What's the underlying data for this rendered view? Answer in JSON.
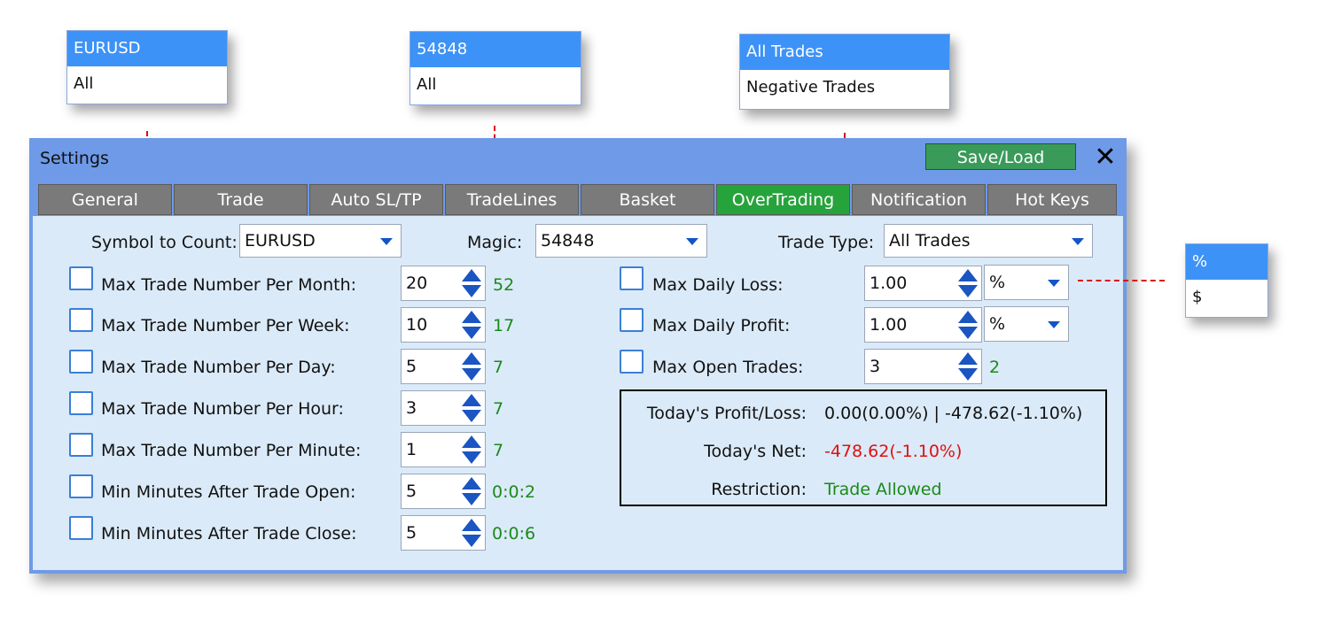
{
  "popups": {
    "symbol": {
      "options": [
        "EURUSD",
        "All"
      ],
      "selected": "EURUSD"
    },
    "magic": {
      "options": [
        "54848",
        "All"
      ],
      "selected": "54848"
    },
    "trade_type": {
      "options": [
        "All Trades",
        "Negative Trades"
      ],
      "selected": "All Trades"
    },
    "unit": {
      "options": [
        "%",
        "$"
      ],
      "selected": "%"
    }
  },
  "window": {
    "title": "Settings",
    "save_load_label": "Save/Load",
    "close_glyph": "✕"
  },
  "tabs": [
    {
      "label": "General",
      "active": false
    },
    {
      "label": "Trade",
      "active": false
    },
    {
      "label": "Auto SL/TP",
      "active": false
    },
    {
      "label": "TradeLines",
      "active": false
    },
    {
      "label": "Basket",
      "active": false
    },
    {
      "label": "OverTrading",
      "active": true
    },
    {
      "label": "Notification",
      "active": false
    },
    {
      "label": "Hot Keys",
      "active": false
    }
  ],
  "filters": {
    "symbol_label": "Symbol to Count:",
    "symbol_value": "EURUSD",
    "magic_label": "Magic:",
    "magic_value": "54848",
    "trade_type_label": "Trade Type:",
    "trade_type_value": "All Trades"
  },
  "left_rules": [
    {
      "label": "Max Trade Number Per Month:",
      "value": "20",
      "count": "52"
    },
    {
      "label": "Max Trade Number Per Week:",
      "value": "10",
      "count": "17"
    },
    {
      "label": "Max Trade Number Per Day:",
      "value": "5",
      "count": "7"
    },
    {
      "label": "Max Trade Number Per Hour:",
      "value": "3",
      "count": "7"
    },
    {
      "label": "Max Trade Number Per Minute:",
      "value": "1",
      "count": "7"
    },
    {
      "label": "Min Minutes After Trade Open:",
      "value": "5",
      "count": "0:0:2"
    },
    {
      "label": "Min Minutes After Trade Close:",
      "value": "5",
      "count": "0:0:6"
    }
  ],
  "right_rules": [
    {
      "label": "Max Daily Loss:",
      "value": "1.00",
      "unit": "%"
    },
    {
      "label": "Max Daily Profit:",
      "value": "1.00",
      "unit": "%"
    },
    {
      "label": "Max Open Trades:",
      "value": "3",
      "count": "2"
    }
  ],
  "info": {
    "pl_label": "Today's Profit/Loss:",
    "pl_value": "0.00(0.00%) | -478.62(-1.10%)",
    "net_label": "Today's Net:",
    "net_value": "-478.62(-1.10%)",
    "restriction_label": "Restriction:",
    "restriction_value": "Trade Allowed"
  },
  "colors": {
    "selected_option": "#3d92f7",
    "active_tab": "#27a33c",
    "count_green": "#1a8a1a",
    "net_red": "#e01010"
  }
}
